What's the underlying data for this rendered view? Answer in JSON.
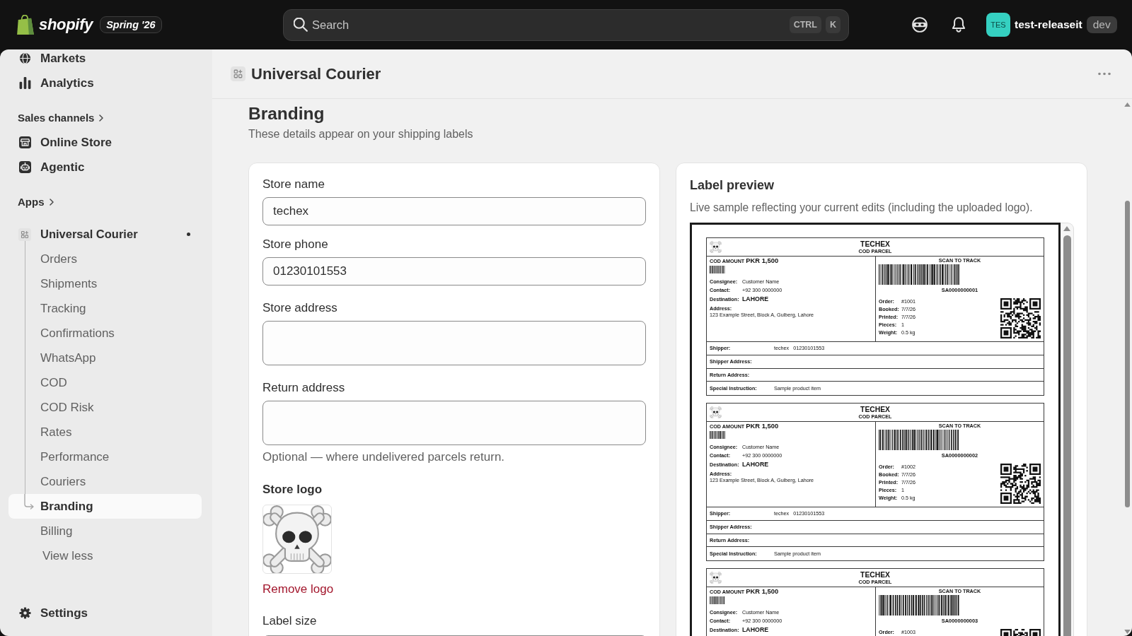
{
  "top_bar": {
    "logo_text": "shopify",
    "edition": "Spring '26",
    "search": {
      "placeholder": "Search",
      "shortcut": [
        "CTRL",
        "K"
      ]
    },
    "account": {
      "initials": "TES",
      "name": "test-releaseit",
      "badge": "dev"
    }
  },
  "sidebar": {
    "items": [
      {
        "kind": "nav",
        "label": "Markets",
        "selected": false
      },
      {
        "kind": "nav",
        "label": "Analytics",
        "selected": false
      },
      {
        "kind": "heading",
        "label": "Sales channels"
      },
      {
        "kind": "nav",
        "label": "Online Store",
        "selected": false
      },
      {
        "kind": "nav",
        "label": "Agentic",
        "selected": false
      },
      {
        "kind": "heading",
        "label": "Apps"
      },
      {
        "kind": "app",
        "label": "Universal Courier",
        "selected": false,
        "indicator": true,
        "children": [
          {
            "label": "Orders",
            "selected": false
          },
          {
            "label": "Shipments",
            "selected": false
          },
          {
            "label": "Tracking",
            "selected": false
          },
          {
            "label": "Confirmations",
            "selected": false
          },
          {
            "label": "WhatsApp",
            "selected": false
          },
          {
            "label": "COD",
            "selected": false
          },
          {
            "label": "COD Risk",
            "selected": false
          },
          {
            "label": "Rates",
            "selected": false
          },
          {
            "label": "Performance",
            "selected": false
          },
          {
            "label": "Couriers",
            "selected": false
          },
          {
            "label": "Branding",
            "selected": true
          },
          {
            "label": "Billing",
            "selected": false
          }
        ],
        "toggle": "View less"
      }
    ],
    "footer": {
      "label": "Settings",
      "selected": false
    }
  },
  "page": {
    "title": "Universal Courier",
    "heading": "Branding",
    "subtitle": "These details appear on your shipping labels"
  },
  "form": {
    "fields": [
      {
        "kind": "text",
        "label": "Store name",
        "value": "techex"
      },
      {
        "kind": "text",
        "label": "Store phone",
        "value": "01230101553"
      },
      {
        "kind": "textarea",
        "label": "Store address"
      },
      {
        "kind": "textarea",
        "label": "Return address",
        "help": "Optional — where undelivered parcels return."
      },
      {
        "kind": "logo",
        "label": "Store logo",
        "action": "Remove logo"
      },
      {
        "kind": "select",
        "label": "Label size"
      }
    ]
  },
  "preview": {
    "title": "Label preview",
    "description": "Live sample reflecting your current edits (including the uploaded logo).",
    "labels": [
      {
        "brand": "TECHEX",
        "subtitle": "COD PARCEL",
        "cod_caption": "COD AMOUNT",
        "cod_amount": "PKR 1,500",
        "consignee": [
          {
            "label": "Consignee:",
            "value": "Customer Name",
            "kind": "plain"
          },
          {
            "label": "Contact:",
            "value": "+92 300 0000000",
            "kind": "plain"
          },
          {
            "label": "Destination:",
            "value": "LAHORE",
            "kind": "emphasis"
          }
        ],
        "address_label": "Address:",
        "address": "123 Example Street, Block A, Gulberg, Lahore",
        "scan_caption": "SCAN TO TRACK",
        "tracking_number": "SA0000000001",
        "details": [
          {
            "label": "Order:",
            "value": "#1001"
          },
          {
            "label": "Booked:",
            "value": "7/7/26"
          },
          {
            "label": "Printed:",
            "value": "7/7/26"
          },
          {
            "label": "Pieces:",
            "value": "1"
          },
          {
            "label": "Weight:",
            "value": "0.5 kg"
          }
        ],
        "rows": [
          {
            "label": "Shipper:",
            "values": [
              "techex",
              "01230101553"
            ]
          },
          {
            "label": "Shipper Address:"
          },
          {
            "label": "Return Address:"
          },
          {
            "label": "Special Instruction:",
            "values": [
              "Sample product item"
            ]
          }
        ]
      },
      {
        "brand": "TECHEX",
        "subtitle": "COD PARCEL",
        "cod_caption": "COD AMOUNT",
        "cod_amount": "PKR 1,500",
        "consignee": [
          {
            "label": "Consignee:",
            "value": "Customer Name",
            "kind": "plain"
          },
          {
            "label": "Contact:",
            "value": "+92 300 0000000",
            "kind": "plain"
          },
          {
            "label": "Destination:",
            "value": "LAHORE",
            "kind": "emphasis"
          }
        ],
        "address_label": "Address:",
        "address": "123 Example Street, Block A, Gulberg, Lahore",
        "scan_caption": "SCAN TO TRACK",
        "tracking_number": "SA0000000002",
        "details": [
          {
            "label": "Order:",
            "value": "#1002"
          },
          {
            "label": "Booked:",
            "value": "7/7/26"
          },
          {
            "label": "Printed:",
            "value": "7/7/26"
          },
          {
            "label": "Pieces:",
            "value": "1"
          },
          {
            "label": "Weight:",
            "value": "0.5 kg"
          }
        ],
        "rows": [
          {
            "label": "Shipper:",
            "values": [
              "techex",
              "01230101553"
            ]
          },
          {
            "label": "Shipper Address:"
          },
          {
            "label": "Return Address:"
          },
          {
            "label": "Special Instruction:",
            "values": [
              "Sample product item"
            ]
          }
        ]
      },
      {
        "brand": "TECHEX",
        "subtitle": "COD PARCEL",
        "cod_caption": "COD AMOUNT",
        "cod_amount": "PKR 1,500",
        "consignee": [
          {
            "label": "Consignee:",
            "value": "Customer Name",
            "kind": "plain"
          },
          {
            "label": "Contact:",
            "value": "+92 300 0000000",
            "kind": "plain"
          },
          {
            "label": "Destination:",
            "value": "LAHORE",
            "kind": "emphasis"
          }
        ],
        "scan_caption": "SCAN TO TRACK",
        "tracking_number": "SA0000000003",
        "details": [
          {
            "label": "Order:",
            "value": "#1003"
          }
        ]
      }
    ]
  }
}
